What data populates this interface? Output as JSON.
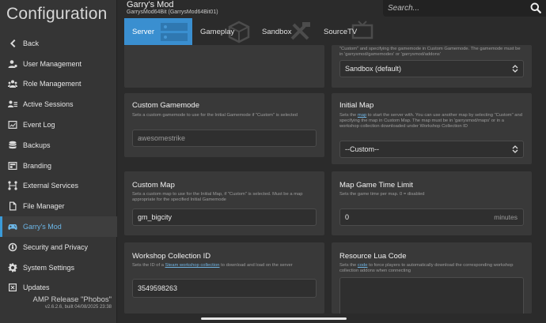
{
  "app": {
    "title": "Configuration",
    "release_name": "AMP Release \"Phobos\"",
    "release_version": "v2.6.2.6, built 04/08/2025 23:38"
  },
  "server": {
    "name": "Garry's Mod",
    "instance": "GarrysMod64Bit (GarrysMod64Bit01)"
  },
  "search": {
    "placeholder": "Search..."
  },
  "sidebar": {
    "items": [
      {
        "label": "Back",
        "icon": "chevron-left-icon"
      },
      {
        "label": "User Management",
        "icon": "user-cog-icon"
      },
      {
        "label": "Role Management",
        "icon": "users-icon"
      },
      {
        "label": "Active Sessions",
        "icon": "sessions-icon"
      },
      {
        "label": "Event Log",
        "icon": "event-log-icon"
      },
      {
        "label": "Backups",
        "icon": "database-icon"
      },
      {
        "label": "Branding",
        "icon": "branding-icon"
      },
      {
        "label": "External Services",
        "icon": "network-icon"
      },
      {
        "label": "File Manager",
        "icon": "file-icon"
      },
      {
        "label": "Garry's Mod",
        "icon": "gamepad-icon"
      },
      {
        "label": "Security and Privacy",
        "icon": "shield-icon"
      },
      {
        "label": "System Settings",
        "icon": "gear-icon"
      },
      {
        "label": "Updates",
        "icon": "update-icon"
      }
    ],
    "active_index": 9
  },
  "tabs": [
    {
      "label": "Server"
    },
    {
      "label": "Gameplay"
    },
    {
      "label": "Sandbox"
    },
    {
      "label": "SourceTV"
    }
  ],
  "cards": {
    "gamemode": {
      "desc": "\"Custom\" and specifying the gamemode in Custom Gamemode. The gamemode must be in 'garrysmod/gamemodes' or 'garrysmod/addons'",
      "value": "Sandbox (default)"
    },
    "custom_gamemode": {
      "title": "Custom Gamemode",
      "desc": "Sets a custom gamemode to use for the Initial Gamemode if \"Custom\" is selected",
      "placeholder": "awesomestrike"
    },
    "initial_map": {
      "title": "Initial Map",
      "desc_pre": "Sets the ",
      "desc_link": "map",
      "desc_post": " to start the server with. You can use another map by selecting \"Custom\" and specifying the map in Custom Map. The map must be in 'garrysmod/maps' or in a workshop collection downloaded under Workshop Collection ID",
      "value": "--Custom--"
    },
    "custom_map": {
      "title": "Custom Map",
      "desc": "Sets a custom map to use for the Initial Map, if \"Custom\" is selected. Must be a map appropriate for the specified Initial Gamemode",
      "value": "gm_bigcity"
    },
    "time_limit": {
      "title": "Map Game Time Limit",
      "desc": "Sets the game time per map. 0 = disabled",
      "value": "0",
      "unit": "minutes"
    },
    "workshop": {
      "title": "Workshop Collection ID",
      "desc_pre": "Sets the ID of a ",
      "desc_link": "Steam workshop collection",
      "desc_post": " to download and load on the server",
      "value": "3549598263"
    },
    "lua_code": {
      "title": "Resource Lua Code",
      "desc_pre": "Sets the ",
      "desc_link": "code",
      "desc_post": " to force players to automatically download the corresponding workshop collection addons when connecting"
    }
  },
  "colors": {
    "accent": "#3a8fd0",
    "background": "#2b2b2b",
    "card": "#393939",
    "sidebar": "#353535"
  }
}
